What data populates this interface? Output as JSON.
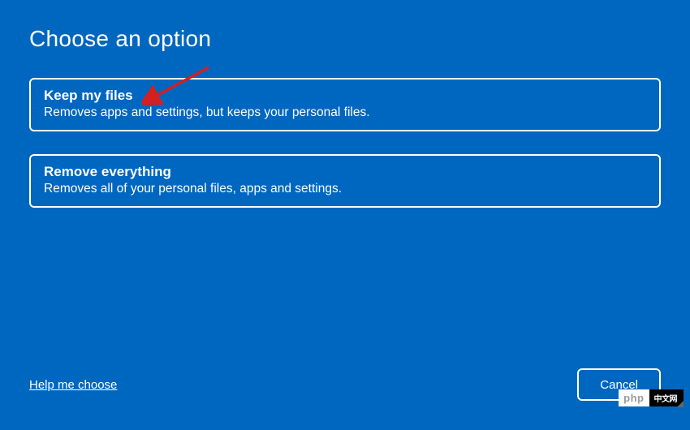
{
  "title": "Choose an option",
  "options": [
    {
      "title": "Keep my files",
      "description": "Removes apps and settings, but keeps your personal files."
    },
    {
      "title": "Remove everything",
      "description": "Removes all of your personal files, apps and settings."
    }
  ],
  "footer": {
    "help_link": "Help me choose",
    "cancel_label": "Cancel"
  },
  "watermark": {
    "left": "php",
    "right": "中文网"
  }
}
